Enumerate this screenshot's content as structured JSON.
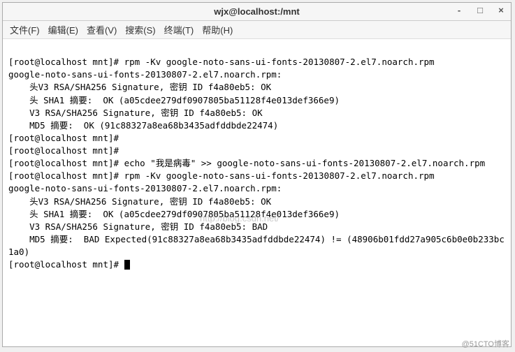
{
  "window": {
    "title": "wjx@localhost:/mnt"
  },
  "menu": {
    "file": "文件(F)",
    "edit": "编辑(E)",
    "view": "查看(V)",
    "search": "搜索(S)",
    "terminal": "终端(T)",
    "help": "帮助(H)"
  },
  "controls": {
    "minimize": "-",
    "maximize": "□",
    "close": "×"
  },
  "terminal_lines": {
    "l01": "[root@localhost mnt]# rpm -Kv google-noto-sans-ui-fonts-20130807-2.el7.noarch.rpm",
    "l02": "google-noto-sans-ui-fonts-20130807-2.el7.noarch.rpm:",
    "l03": "    头V3 RSA/SHA256 Signature, 密钥 ID f4a80eb5: OK",
    "l04": "    头 SHA1 摘要:  OK (a05cdee279df0907805ba51128f4e013def366e9)",
    "l05": "    V3 RSA/SHA256 Signature, 密钥 ID f4a80eb5: OK",
    "l06": "    MD5 摘要:  OK (91c88327a8ea68b3435adfddbde22474)",
    "l07": "[root@localhost mnt]# ",
    "l08": "[root@localhost mnt]# ",
    "l09": "[root@localhost mnt]# echo \"我是病毒\" >> google-noto-sans-ui-fonts-20130807-2.el7.noarch.rpm",
    "l10": "[root@localhost mnt]# rpm -Kv google-noto-sans-ui-fonts-20130807-2.el7.noarch.rpm",
    "l11": "google-noto-sans-ui-fonts-20130807-2.el7.noarch.rpm:",
    "l12": "    头V3 RSA/SHA256 Signature, 密钥 ID f4a80eb5: OK",
    "l13": "    头 SHA1 摘要:  OK (a05cdee279df0907805ba51128f4e013def366e9)",
    "l14": "    V3 RSA/SHA256 Signature, 密钥 ID f4a80eb5: BAD",
    "l15": "    MD5 摘要:  BAD Expected(91c88327a8ea68b3435adfddbde22474) != (48906b01fdd27a905c6b0e0b233bc1a0)",
    "l16": "[root@localhost mnt]# "
  },
  "watermark": "http://blog.csdn.net/",
  "footer": "@51CTO博客"
}
